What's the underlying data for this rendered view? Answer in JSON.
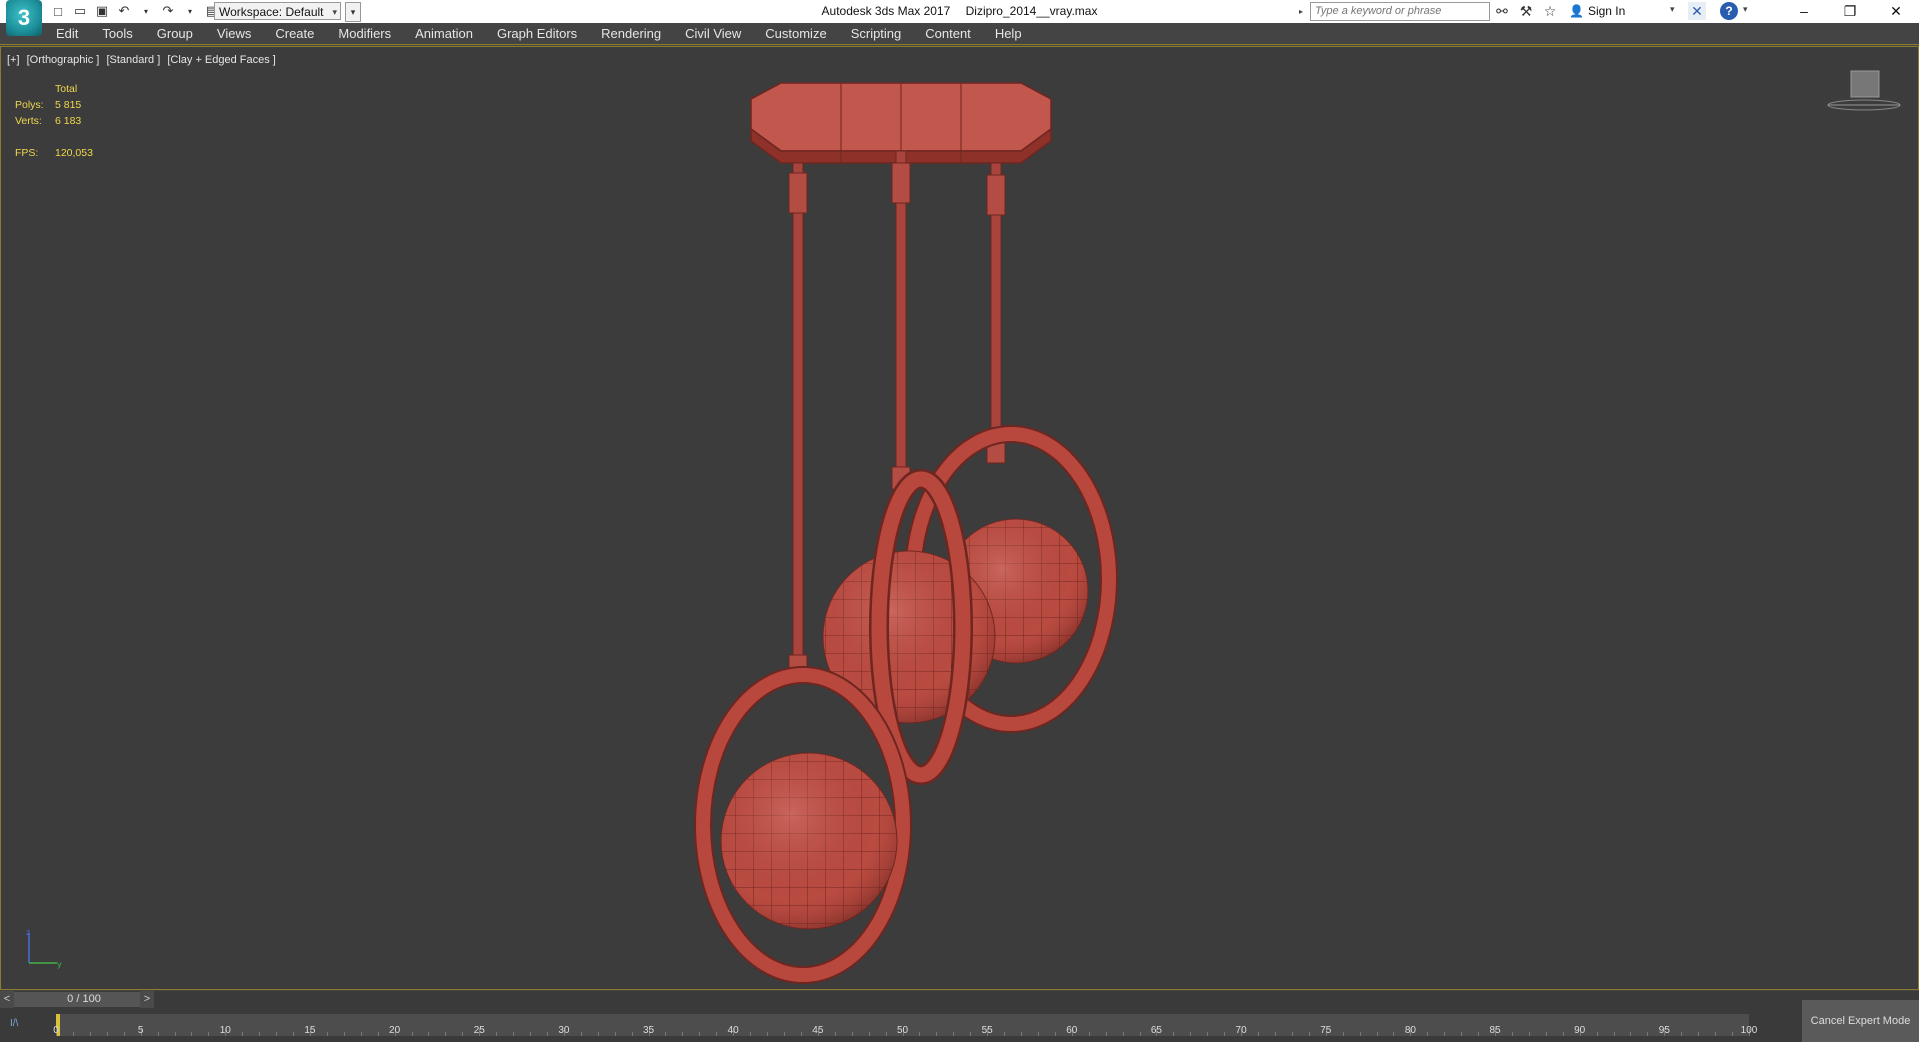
{
  "window": {
    "app_title": "Autodesk 3ds Max 2017",
    "file_name": "Dizipro_2014__vray.max",
    "logo_text": "3"
  },
  "quick_access": {
    "workspace_label": "Workspace: Default"
  },
  "search": {
    "placeholder": "Type a keyword or phrase"
  },
  "account": {
    "sign_in_label": "Sign In",
    "help_label": "?"
  },
  "menu": {
    "items": [
      "Edit",
      "Tools",
      "Group",
      "Views",
      "Create",
      "Modifiers",
      "Animation",
      "Graph Editors",
      "Rendering",
      "Civil View",
      "Customize",
      "Scripting",
      "Content",
      "Help"
    ]
  },
  "viewport": {
    "labels": [
      "[+]",
      "[Orthographic ]",
      "[Standard ]",
      "[Clay + Edged Faces ]"
    ],
    "stats": {
      "header": "Total",
      "polys_label": "Polys:",
      "polys_value": "5 815",
      "verts_label": "Verts:",
      "verts_value": "6 183",
      "fps_label": "FPS:",
      "fps_value": "120,053"
    },
    "model_color": "#b5493f"
  },
  "timeline": {
    "position_label": "0 / 100",
    "prev_label": "<",
    "next_label": ">",
    "ticks": [
      "0",
      "5",
      "10",
      "15",
      "20",
      "25",
      "30",
      "35",
      "40",
      "45",
      "50",
      "55",
      "60",
      "65",
      "70",
      "75",
      "80",
      "85",
      "90",
      "95",
      "100"
    ],
    "current_frame": 0
  },
  "expert_mode": {
    "label": "Cancel Expert Mode"
  }
}
